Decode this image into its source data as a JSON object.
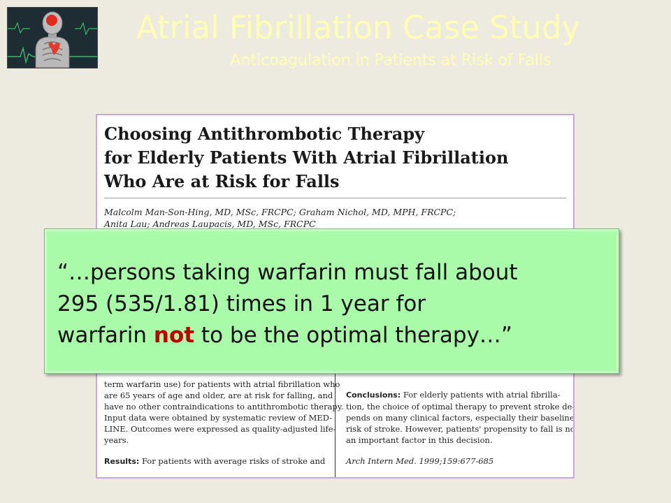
{
  "slide": {
    "title": "Atrial Fibrillation Case Study",
    "subtitle": "Anticoagulation in Patients at Risk of Falls",
    "colors": {
      "background": "#edeae0",
      "title": "#fdfdb4",
      "quote_box": "#a9fba9",
      "highlight": "#c00000",
      "paper_border": "#c7a6e6"
    }
  },
  "logo": {
    "icon": "human-anatomy-heart-icon"
  },
  "paper": {
    "title_lines": [
      "Choosing Antithrombotic Therapy",
      "for Elderly Patients With Atrial Fibrillation",
      "Who Are at Risk for Falls"
    ],
    "author_lines": [
      "Malcolm Man-Son-Hing, MD, MSc, FRCPC; Graham Nichol, MD, MPH, FRCPC;",
      "Anita Lau; Andreas Laupacis, MD, MSc, FRCPC"
    ],
    "left_column_lines": [
      "term warfarin use) for patients with atrial fibrillation who",
      "are 65 years of age and older, are at risk for falling, and",
      "have no other contraindications to antithrombotic therapy.",
      "Input data were obtained by systematic review of MED-",
      "LINE. Outcomes were expressed as quality-adjusted life-",
      "years."
    ],
    "results_label": "Results:",
    "results_text": " For patients with average risks of stroke and",
    "conclusions_label": "Conclusions:",
    "conclusions_first": " For elderly patients with atrial fibrilla-",
    "right_column_lines": [
      "tion, the choice of optimal therapy to prevent stroke de-",
      "pends on many clinical factors, especially their baseline",
      "risk of stroke. However, patients' propensity to fall is not",
      "an important factor in this decision."
    ],
    "citation": "Arch Intern Med. 1999;159:677-685"
  },
  "quote": {
    "line1": "“…persons taking warfarin must fall about",
    "line2": "295 (535/1.81) times in 1 year for",
    "line3_before": "warfarin ",
    "line3_emphasis": "not",
    "line3_after": " to be the optimal therapy…”"
  }
}
